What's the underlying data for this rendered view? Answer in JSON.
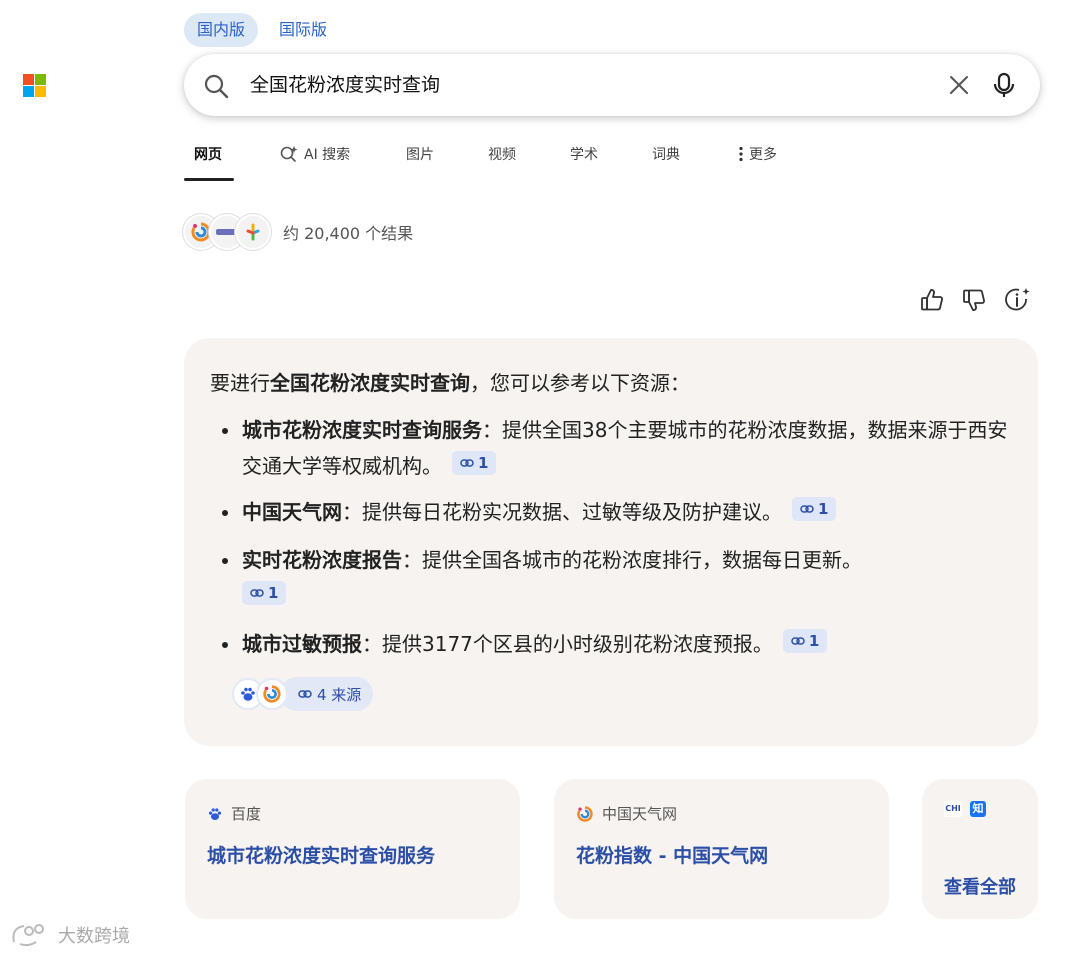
{
  "edition_tabs": [
    {
      "label": "国内版",
      "active": true
    },
    {
      "label": "国际版",
      "active": false
    }
  ],
  "search": {
    "query": "全国花粉浓度实时查询",
    "icons": [
      "search-icon",
      "clear-icon",
      "microphone-icon"
    ]
  },
  "nav": {
    "items": [
      {
        "label": "网页",
        "active": true
      },
      {
        "label": "AI 搜索",
        "icon": "ai-sparkle-search-icon"
      },
      {
        "label": "图片"
      },
      {
        "label": "视频"
      },
      {
        "label": "学术"
      },
      {
        "label": "词典"
      },
      {
        "label": "更多",
        "icon": "more-vertical-dots-icon"
      }
    ]
  },
  "results": {
    "count_text": "约 20,400 个结果"
  },
  "feedback_icons": [
    "thumbs-up-icon",
    "thumbs-down-icon",
    "info-sparkle-icon"
  ],
  "answer": {
    "intro_prefix": "要进行",
    "intro_bold": "全国花粉浓度实时查询",
    "intro_suffix": "，您可以参考以下资源：",
    "bullets": [
      {
        "title": "城市花粉浓度实时查询服务",
        "text": "：提供全国38个主要城市的花粉浓度数据，数据来源于西安交通大学等权威机构。",
        "cite": "1"
      },
      {
        "title": "中国天气网",
        "text": "：提供每日花粉实况数据、过敏等级及防护建议。",
        "cite": "1"
      },
      {
        "title": "实时花粉浓度报告",
        "text": "：提供全国各城市的花粉浓度排行，数据每日更新。",
        "cite": "1"
      },
      {
        "title": "城市过敏预报",
        "text": "：提供3177个区县的小时级别花粉浓度预报。",
        "cite": "1"
      }
    ],
    "sources_chip": "4 来源"
  },
  "ref_cards": [
    {
      "source": "百度",
      "title": "城市花粉浓度实时查询服务",
      "icon": "baidu-paw-icon"
    },
    {
      "source": "中国天气网",
      "title": "花粉指数 - 中国天气网",
      "icon": "weather-swirl-icon"
    }
  ],
  "see_all": {
    "label": "查看全部",
    "mini_icon_texts": [
      "CHI",
      "知"
    ]
  },
  "watermark": {
    "text": "大数跨境"
  },
  "colors": {
    "link_blue": "#2b4ea6",
    "tab_blue": "#2b61c9",
    "card_bg": "#f6f3f0",
    "cite_bg": "#dfe6f7"
  }
}
